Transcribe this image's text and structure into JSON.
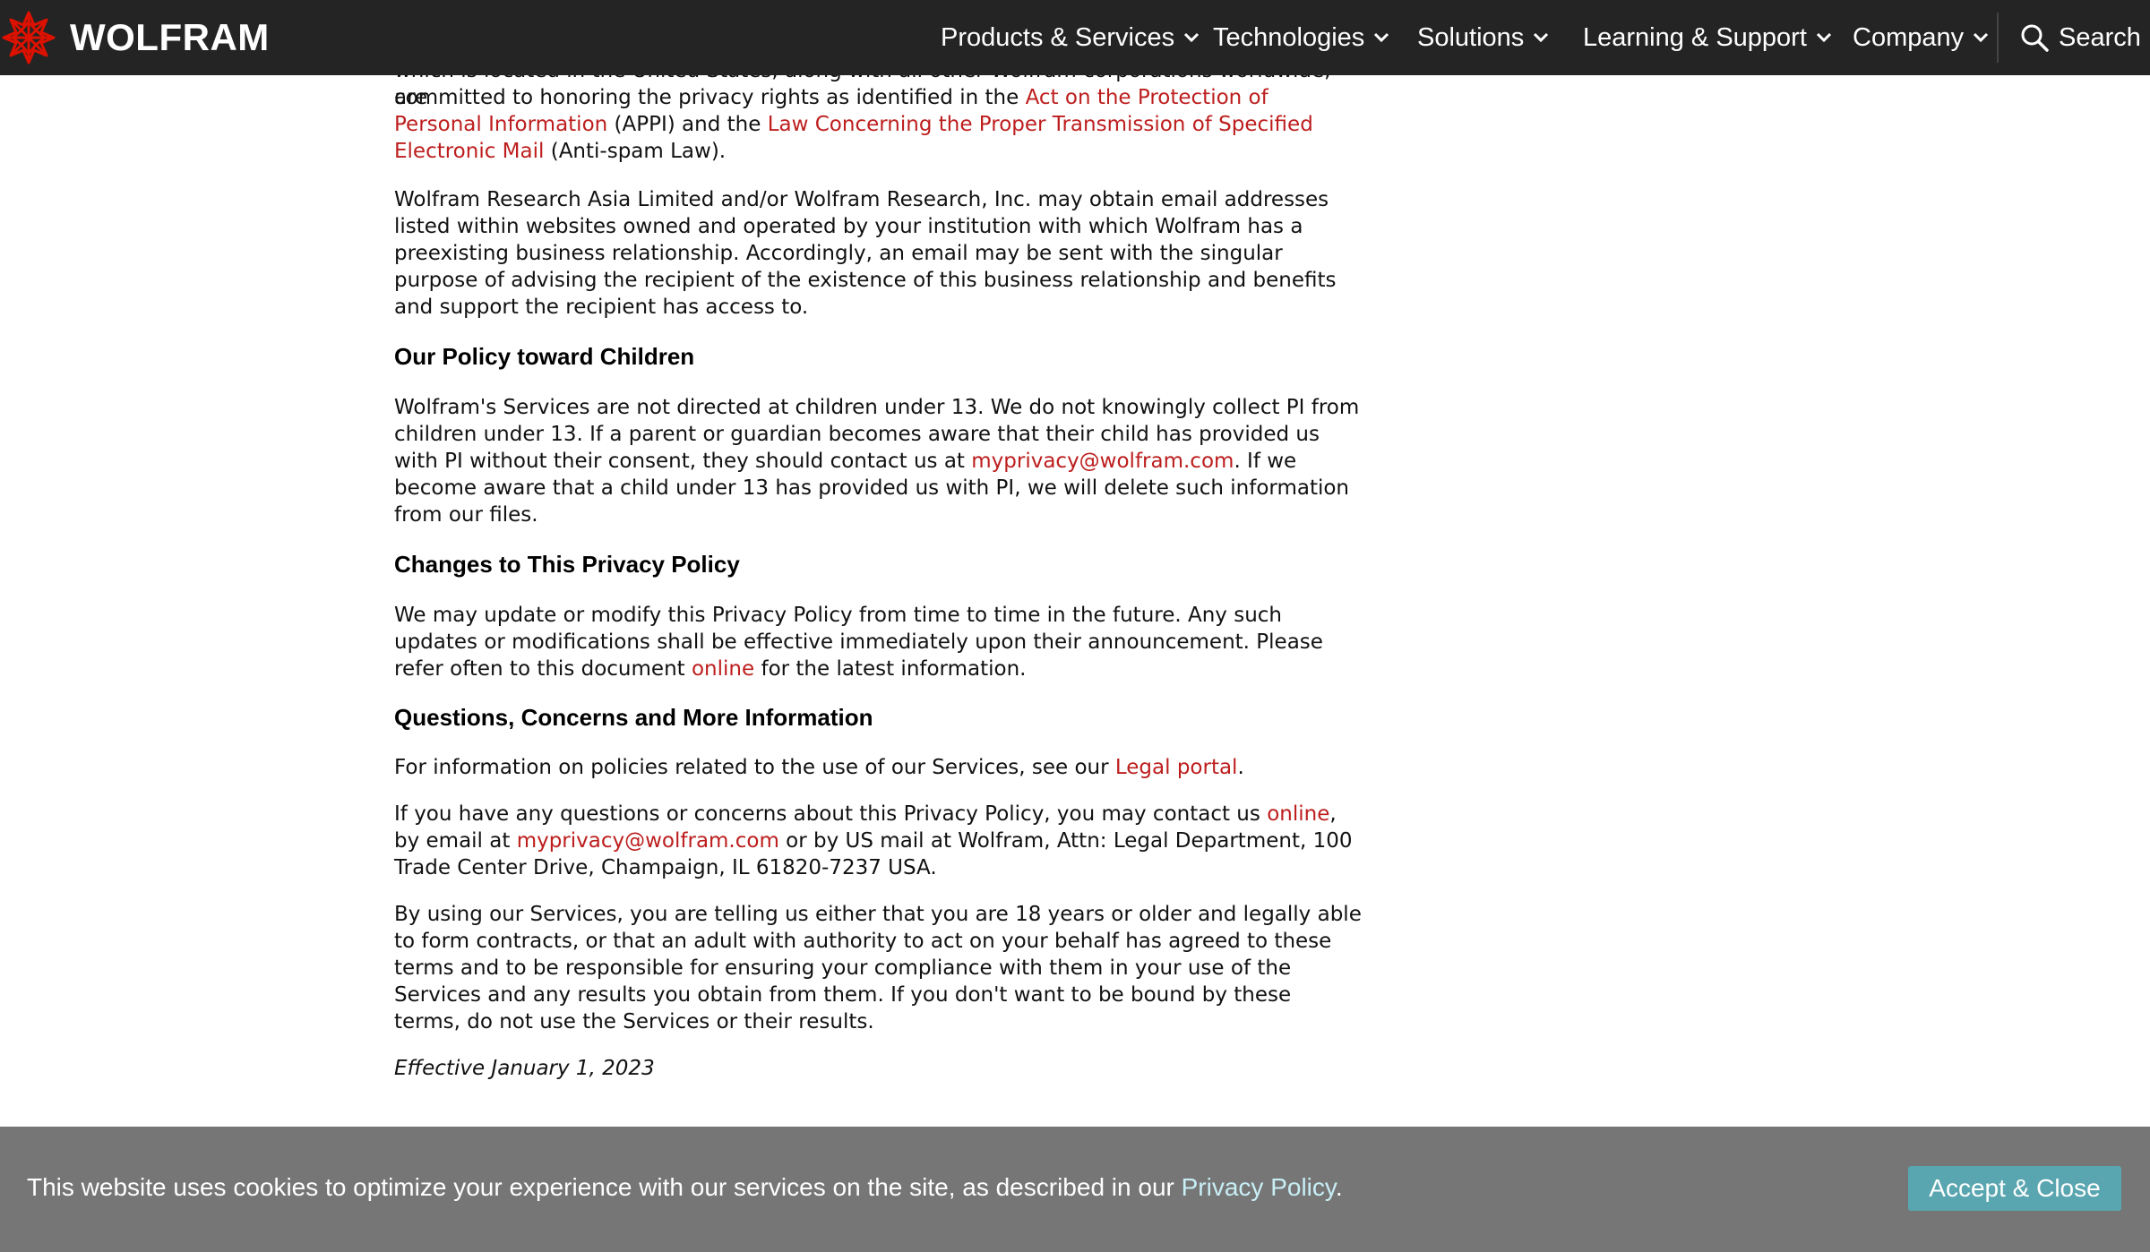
{
  "header": {
    "logo_text": "WOLFRAM",
    "nav": [
      {
        "label": "Products & Services"
      },
      {
        "label": "Technologies"
      },
      {
        "label": "Solutions"
      },
      {
        "label": "Learning & Support"
      },
      {
        "label": "Company"
      }
    ],
    "search_label": "Search"
  },
  "article": {
    "intro": {
      "clipped_line": "which is located in the United States, along with all other Wolfram corporations worldwide, are",
      "text_1": "committed to honoring the privacy rights as identified in the ",
      "link_1": "Act on the Protection of Personal Information",
      "text_2": " (APPI) and the ",
      "link_2": "Law Concerning the Proper Transmission of Specified Electronic Mail",
      "text_3": " (Anti-spam Law)."
    },
    "para_email_addresses": "Wolfram Research Asia Limited and/or Wolfram Research, Inc. may obtain email addresses listed within websites owned and operated by your institution with which Wolfram has a preexisting business relationship. Accordingly, an email may be sent with the singular purpose of advising the recipient of the existence of this business relationship and benefits and support the recipient has access to.",
    "children": {
      "heading": "Our Policy toward Children",
      "text_1": "Wolfram's Services are not directed at children under 13. We do not knowingly collect PI from children under 13. If a parent or guardian becomes aware that their child has provided us with PI without their consent, they should contact us at ",
      "email": "myprivacy@wolfram.com",
      "text_2": ". If we become aware that a child under 13 has provided us with PI, we will delete such information from our files."
    },
    "changes": {
      "heading": "Changes to This Privacy Policy",
      "text_1": "We may update or modify this Privacy Policy from time to time in the future. Any such updates or modifications shall be effective immediately upon their announcement. Please refer often to this document ",
      "link": "online",
      "text_2": " for the latest information."
    },
    "questions": {
      "heading": "Questions, Concerns and More Information",
      "legal_text_1": "For information on policies related to the use of our Services, see our ",
      "legal_link": "Legal portal",
      "legal_text_2": ".",
      "contact_text_1": "If you have any questions or concerns about this Privacy Policy, you may contact us ",
      "contact_link_online": "online",
      "contact_text_2": ", by email at ",
      "contact_email": "myprivacy@wolfram.com",
      "contact_text_3": " or by US mail at Wolfram, Attn: Legal Department, 100 Trade Center Drive, Champaign, IL 61820-7237 USA.",
      "terms": "By using our Services, you are telling us either that you are 18 years or older and legally able to form contracts, or that an adult with authority to act on your behalf has agreed to these terms and to be responsible for ensuring your compliance with them in your use of the Services and any results you obtain from them. If you don't want to be bound by these terms, do not use the Services or their results."
    },
    "effective": "Effective January 1, 2023"
  },
  "cookie_banner": {
    "text": "This website uses cookies to optimize your experience with our services on the site, as described in our ",
    "link": "Privacy Policy",
    "suffix": ".",
    "button": "Accept & Close"
  },
  "colors": {
    "nav_bg": "#242424",
    "link": "#bd1e1e",
    "cookie_bg": "#767676",
    "cookie_button": "#5aa6b0",
    "logo_red": "#dd1100"
  }
}
